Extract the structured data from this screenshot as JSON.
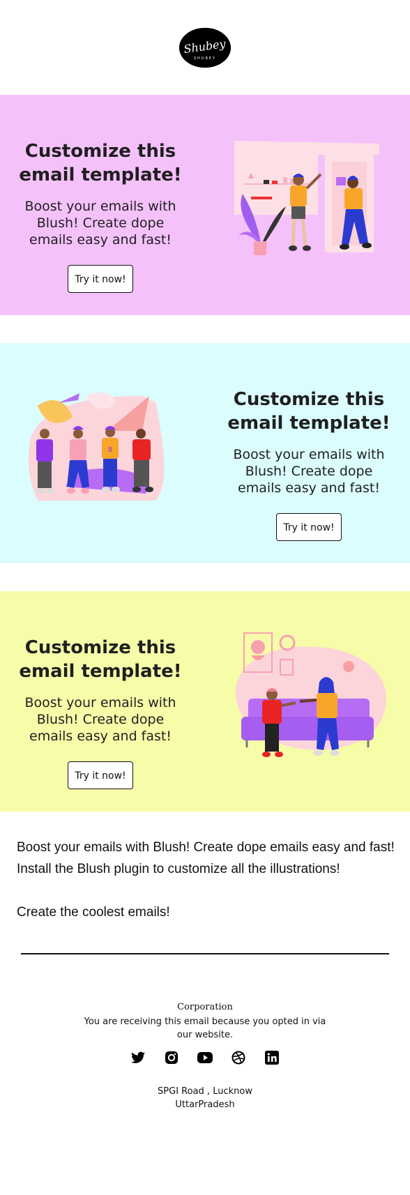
{
  "logo": {
    "text": "Shubey",
    "subtext": "SHUBEY"
  },
  "sections": [
    {
      "title": "Customize this email template!",
      "subtitle": "Boost your emails with Blush! Create dope emails easy and fast!",
      "button": "Try it now!",
      "background": "#f5c1fb"
    },
    {
      "title": "Customize this email template!",
      "subtitle": "Boost your emails with Blush! Create dope emails easy and fast!",
      "button": "Try it now!",
      "background": "#dbfdfe"
    },
    {
      "title": "Customize this email template!",
      "subtitle": "Boost your emails with Blush! Create dope emails easy and fast!",
      "button": "Try it now!",
      "background": "#f6fca8"
    }
  ],
  "body": {
    "line1": "Boost your emails with Blush! Create dope emails easy and fast!",
    "line2": "Install the Blush plugin to customize all the illustrations!",
    "line3": "Create the coolest emails!"
  },
  "footer": {
    "company": "Corporation",
    "optin": "You are receiving this email because you opted in via our website.",
    "social": [
      "twitter-icon",
      "instagram-icon",
      "youtube-icon",
      "dribbble-icon",
      "linkedin-icon"
    ],
    "address_line1": "SPGI Road , Lucknow",
    "address_line2": "UttarPradesh"
  }
}
